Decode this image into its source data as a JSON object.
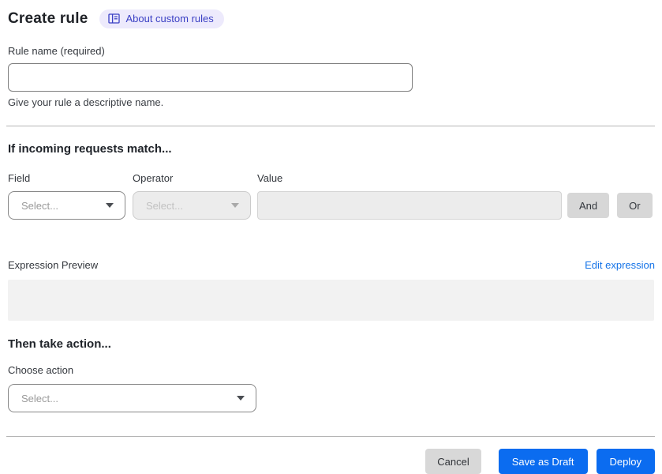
{
  "header": {
    "title": "Create rule",
    "badge_label": "About custom rules",
    "badge_icon": "book-icon"
  },
  "rule_name": {
    "label": "Rule name (required)",
    "value": "",
    "helper": "Give your rule a descriptive name."
  },
  "match": {
    "heading": "If incoming requests match...",
    "field_label": "Field",
    "field_placeholder": "Select...",
    "operator_label": "Operator",
    "operator_placeholder": "Select...",
    "value_label": "Value",
    "value": "",
    "and_label": "And",
    "or_label": "Or"
  },
  "expression": {
    "label": "Expression Preview",
    "edit_link": "Edit expression",
    "content": ""
  },
  "action": {
    "heading": "Then take action...",
    "choose_label": "Choose action",
    "placeholder": "Select..."
  },
  "footer": {
    "cancel": "Cancel",
    "save_draft": "Save as Draft",
    "deploy": "Deploy"
  },
  "icons": {
    "badge": "book-icon",
    "dropdowns": "chevron-down-icon"
  },
  "colors": {
    "primary_blue": "#0b6cf0",
    "link_blue": "#1674e8",
    "badge_bg": "#edeafc",
    "badge_text": "#3b40c4",
    "disabled_bg": "#ececec",
    "preview_bg": "#f2f2f2",
    "chip_gray": "#d7d7d7",
    "divider": "#b5b5b5",
    "heading_text": "#20242a"
  }
}
